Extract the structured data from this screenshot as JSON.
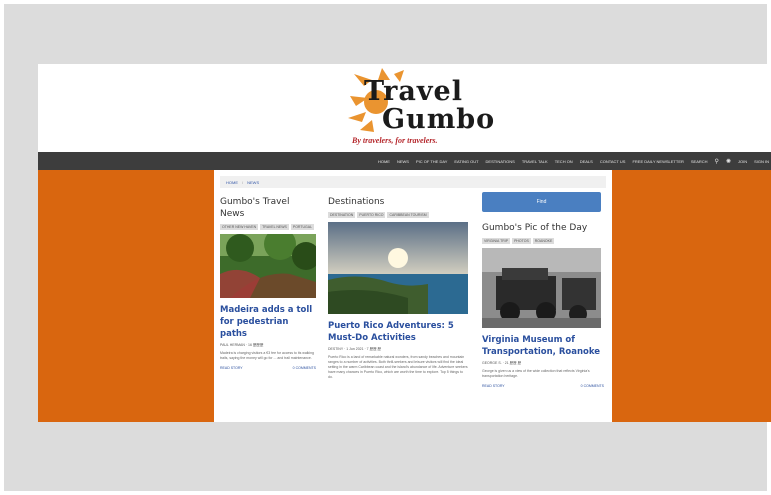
{
  "header": {
    "logo_line1": "Travel",
    "logo_line2": "Gumbo",
    "tagline": "By travelers, for travelers."
  },
  "nav": {
    "items": [
      "HOME",
      "NEWS",
      "PIC OF THE DAY",
      "EATING OUT",
      "DESTINATIONS",
      "TRAVEL TALK",
      "TECH ON",
      "DEALS",
      "CONTACT US",
      "FREE DAILY NEWSLETTER"
    ],
    "search_label": "SEARCH",
    "join_label": "JOIN",
    "signin_label": "SIGN IN"
  },
  "breadcrumb": {
    "home": "HOME",
    "current": "NEWS"
  },
  "news": {
    "heading": "Gumbo's Travel News",
    "tags": [
      "OTHER NEW HAVEN",
      "TRAVEL NEWS",
      "PORTUGAL"
    ],
    "title": "Madeira adds a toll for pedestrian paths",
    "meta": "PAUL HERMAN · 16 歷歷歷",
    "excerpt": "Madeira is charging visitors a €3 fee for access to its walking trails, saying the money will go for ... and trail maintenance.",
    "read_more": "READ STORY",
    "comments": "0 COMMENTS"
  },
  "destinations": {
    "heading": "Destinations",
    "tags": [
      "DESTINATION",
      "PUERTO RICO",
      "CARIBBEAN TOURISM"
    ],
    "title": "Puerto Rico Adventures: 5 Must-Do Activities",
    "meta": "DESTINY · 1 Jun 2021 · 7 歷歷 歷",
    "excerpt": "Puerto Rico is a land of remarkable natural wonders, from sandy beaches and mountain ranges to a number of activities. Both thrill-seekers and leisure visitors will find the ideal setting in the warm Caribbean coast and the island's abundance of life. Adventure seekers have many chances in Puerto Rico, which are worth the time to explore. Top 5 things to do."
  },
  "pic": {
    "find_label": "Find",
    "heading": "Gumbo's Pic of the Day",
    "tags": [
      "VIRGINIA TRIP",
      "PHOTOS",
      "ROANOKE"
    ],
    "title": "Virginia Museum of Transportation, Roanoke",
    "meta": "GEORGE S. · 21 歷歷 歷",
    "excerpt": "George is given us a view of the wide collection that reflects Virginia's transportation heritage.",
    "read_more": "READ STORY",
    "comments": "0 COMMENTS"
  },
  "colors": {
    "accent": "#d9660f",
    "nav_bg": "#3d3d3d",
    "link": "#2a4f9e",
    "button": "#4a7fc1"
  }
}
